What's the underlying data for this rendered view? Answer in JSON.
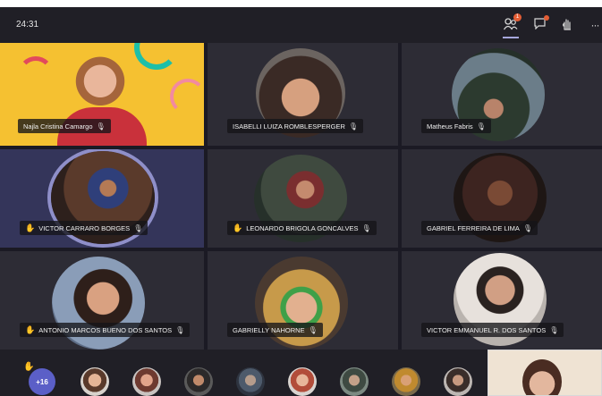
{
  "meeting": {
    "timer": "24:31"
  },
  "toolbar": {
    "participants_badge": "1",
    "participants_icon": "people-icon",
    "chat_icon": "chat-icon",
    "raise_hand_icon": "raise-hand-icon",
    "more_label": "···"
  },
  "participants": [
    {
      "name": "Najla Cristina Camargo",
      "hand_raised": false
    },
    {
      "name": "ISABELLI LUIZA ROMBLESPERGER",
      "hand_raised": false
    },
    {
      "name": "Matheus Fabris",
      "hand_raised": false
    },
    {
      "name": "VICTOR CARRARO BORGES",
      "hand_raised": true
    },
    {
      "name": "LEONARDO BRIGOLA GONCALVES",
      "hand_raised": true
    },
    {
      "name": "GABRIEL FERREIRA DE LIMA",
      "hand_raised": false
    },
    {
      "name": "ANTONIO MARCOS BUENO DOS SANTOS",
      "hand_raised": true
    },
    {
      "name": "GABRIELLY NAHORNE",
      "hand_raised": false
    },
    {
      "name": "VICTOR EMMANUEL R. DOS SANTOS",
      "hand_raised": false
    }
  ],
  "overflow": {
    "count_label": "+16"
  },
  "colors": {
    "accent": "#5b5fc7",
    "speaking_ring": "#8f8fc9",
    "raised_hand": "#f2b739",
    "background": "#1b1a24"
  }
}
